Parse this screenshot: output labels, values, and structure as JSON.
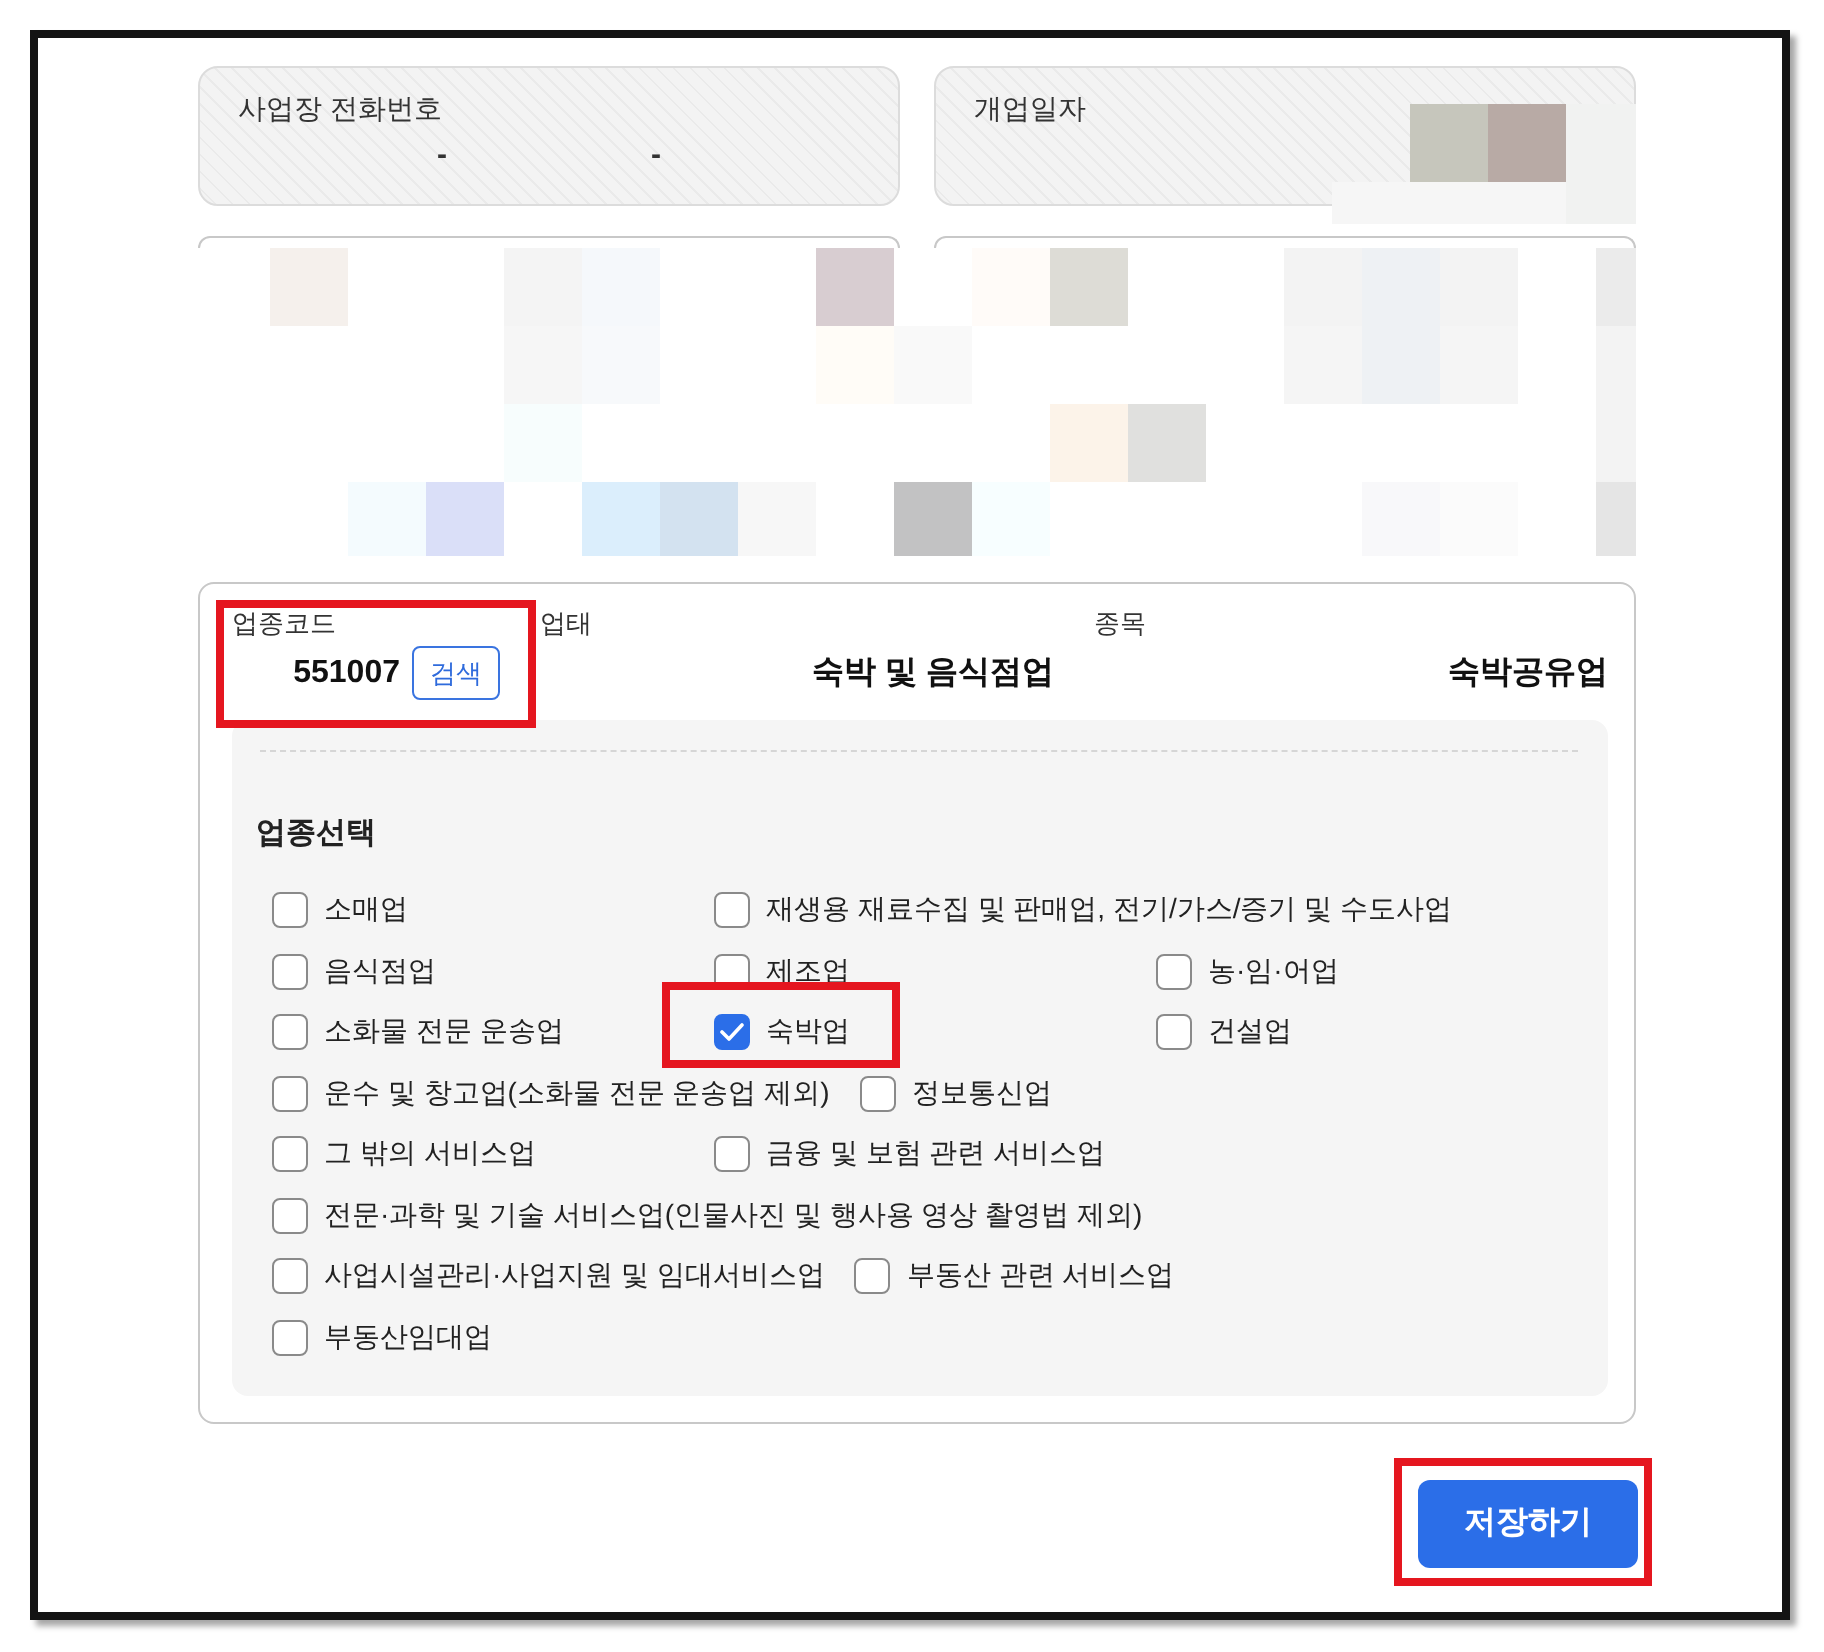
{
  "top_fields": [
    {
      "kind": "phone",
      "label": "사업장 전화번호",
      "separators": [
        "-",
        "-"
      ]
    },
    {
      "kind": "redacted",
      "label": "개업일자"
    }
  ],
  "business": {
    "code": {
      "label": "업종코드",
      "value": "551007",
      "button": "검색",
      "highlighted": true
    },
    "columns": [
      {
        "label": "업태",
        "value": "숙박 및 음식점업"
      },
      {
        "label": "종목",
        "value": "숙박공유업"
      }
    ]
  },
  "industry_select": {
    "title": "업종선택",
    "rows": [
      {
        "options": [
          {
            "label": "소매업",
            "checked": false,
            "highlighted": false
          },
          {
            "label": "재생용 재료수집 및 판매업, 전기/가스/증기 및 수도사업",
            "checked": false,
            "highlighted": false
          }
        ]
      },
      {
        "options": [
          {
            "label": "음식점업",
            "checked": false,
            "highlighted": false
          },
          {
            "label": "제조업",
            "checked": false,
            "highlighted": false
          },
          {
            "label": "농·임·어업",
            "checked": false,
            "highlighted": false
          }
        ]
      },
      {
        "options": [
          {
            "label": "소화물 전문 운송업",
            "checked": false,
            "highlighted": false
          },
          {
            "label": "숙박업",
            "checked": true,
            "highlighted": true
          },
          {
            "label": "건설업",
            "checked": false,
            "highlighted": false
          }
        ]
      },
      {
        "options": [
          {
            "label": "운수 및 창고업(소화물 전문 운송업 제외)",
            "checked": false,
            "highlighted": false
          },
          {
            "label": "정보통신업",
            "checked": false,
            "highlighted": false
          }
        ]
      },
      {
        "options": [
          {
            "label": "그 밖의 서비스업",
            "checked": false,
            "highlighted": false
          },
          {
            "label": "금융 및 보험 관련 서비스업",
            "checked": false,
            "highlighted": false
          }
        ]
      },
      {
        "options": [
          {
            "label": "전문·과학 및 기술 서비스업(인물사진 및 행사용 영상 촬영법 제외)",
            "checked": false,
            "highlighted": false
          }
        ]
      },
      {
        "options": [
          {
            "label": "사업시설관리·사업지원 및 임대서비스업",
            "checked": false,
            "highlighted": false
          },
          {
            "label": "부동산 관련 서비스업",
            "checked": false,
            "highlighted": false
          }
        ]
      },
      {
        "options": [
          {
            "label": "부동산임대업",
            "checked": false,
            "highlighted": false
          }
        ]
      }
    ]
  },
  "save_button": {
    "label": "저장하기",
    "highlighted": true
  }
}
